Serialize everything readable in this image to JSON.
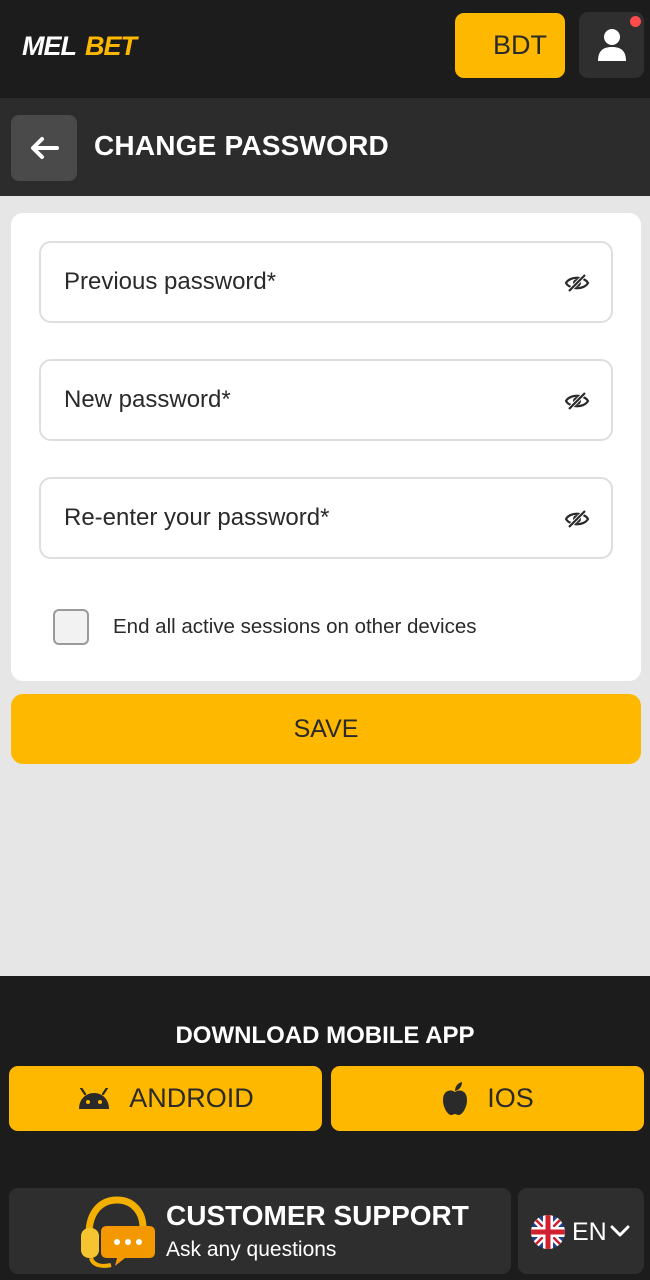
{
  "header": {
    "logo_text": "MELBET",
    "balance_label": "BDT"
  },
  "subheader": {
    "title": "CHANGE PASSWORD"
  },
  "form": {
    "previous_password_placeholder": "Previous password*",
    "new_password_placeholder": "New password*",
    "reenter_password_placeholder": "Re-enter your password*",
    "end_sessions_label": "End all active sessions on other devices",
    "end_sessions_checked": false,
    "save_label": "SAVE"
  },
  "footer": {
    "download_title": "DOWNLOAD MOBILE APP",
    "android_label": "ANDROID",
    "ios_label": "IOS",
    "support_title": "CUSTOMER SUPPORT",
    "support_subtitle": "Ask any questions",
    "language_label": "EN"
  },
  "colors": {
    "accent": "#ffb800",
    "header_bg": "#1c1c1c",
    "subheader_bg": "#2c2c2c",
    "page_bg": "#e6e6e6",
    "notification": "#ff4b4b"
  },
  "icons": {
    "back": "arrow-left-icon",
    "user": "user-icon",
    "password_toggle": "eye-slash-icon",
    "android": "android-icon",
    "ios": "apple-icon",
    "support": "headset-chat-icon",
    "language_flag": "uk-flag-icon",
    "language_dropdown": "chevron-down-icon"
  }
}
